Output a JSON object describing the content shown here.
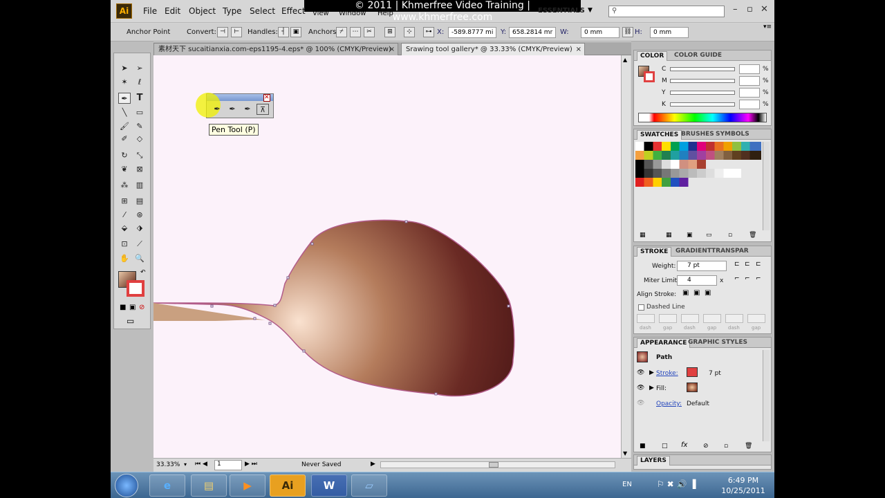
{
  "app": {
    "logo": "Ai"
  },
  "watermark": "© 2011 | Khmerfree Video Training | www.khmerfree.com",
  "menu": [
    "File",
    "Edit",
    "Object",
    "Type",
    "Select",
    "Effect",
    "View",
    "Window",
    "Help"
  ],
  "workspace": "ESSENTIALS",
  "control_bar": {
    "anchor_point": "Anchor Point",
    "convert": "Convert:",
    "handles": "Handles:",
    "anchors": "Anchors:",
    "x_label": "X:",
    "x_value": "-589.8777 mi",
    "y_label": "Y:",
    "y_value": "658.2814 mr",
    "w_label": "W:",
    "w_value": "0 mm",
    "h_label": "H:",
    "h_value": "0 mm"
  },
  "tabs": [
    {
      "label": "素材天下 sucaitianxia.com-eps1195-4.eps* @ 100% (CMYK/Preview)",
      "close": "×"
    },
    {
      "label": "Srawing tool gallery* @ 33.33% (CMYK/Preview)",
      "close": "×"
    }
  ],
  "tooltip": "Pen Tool (P)",
  "status": {
    "zoom": "33.33%",
    "page": "1",
    "saved": "Never Saved"
  },
  "color_panel": {
    "tabs": [
      "COLOR",
      "COLOR GUIDE"
    ],
    "channels": [
      "C",
      "M",
      "Y",
      "K"
    ],
    "unit": "%"
  },
  "swatches_panel": {
    "tabs": [
      "SWATCHES",
      "BRUSHES",
      "SYMBOLS"
    ]
  },
  "stroke_panel": {
    "tabs": [
      "STROKE",
      "GRADIENT",
      "TRANSPAR"
    ],
    "weight_label": "Weight:",
    "weight_value": "7 pt",
    "miter_label": "Miter Limit:",
    "miter_value": "4",
    "miter_unit": "x",
    "align_label": "Align Stroke:",
    "dashed_label": "Dashed Line",
    "dash_labels": [
      "dash",
      "gap",
      "dash",
      "gap",
      "dash",
      "gap"
    ]
  },
  "appearance_panel": {
    "tabs": [
      "APPEARANCE",
      "GRAPHIC STYLES"
    ],
    "title": "Path",
    "stroke_label": "Stroke:",
    "stroke_value": "7 pt",
    "fill_label": "Fill:",
    "opacity_label": "Opacity:",
    "opacity_value": "Default"
  },
  "layers_panel": {
    "tabs": [
      "LAYERS"
    ]
  },
  "taskbar": {
    "apps": [
      "start",
      "ie",
      "explorer",
      "media",
      "Ai",
      "W",
      "app"
    ],
    "lang": "EN",
    "time": "6:49 PM",
    "date": "10/25/2011"
  },
  "colors": {
    "spoon_light": "#f8dcc8",
    "spoon_mid": "#a0674a",
    "spoon_dark": "#4e1818",
    "stroke": "#a85a84",
    "canvas": "#fcf2fa"
  }
}
